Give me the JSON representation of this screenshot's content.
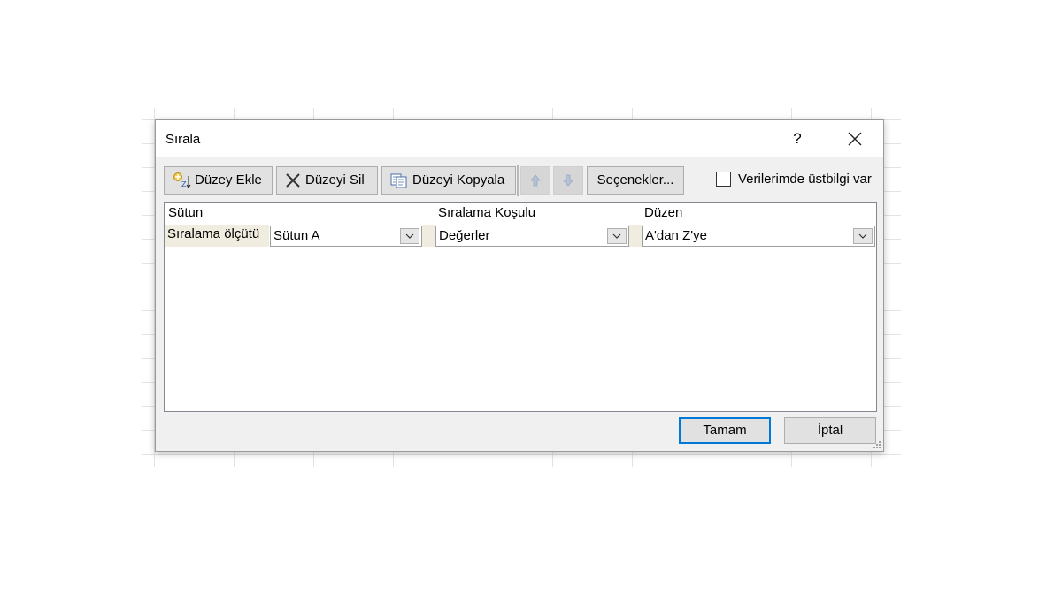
{
  "dialog": {
    "title": "Sırala",
    "help_label": "?"
  },
  "toolbar": {
    "add_level": "Düzey Ekle",
    "delete_level": "Düzeyi Sil",
    "copy_level": "Düzeyi Kopyala",
    "options": "Seçenekler...",
    "header_checkbox_label": "Verilerimde üstbilgi var",
    "header_checkbox_checked": false
  },
  "grid": {
    "columns": [
      "Sütun",
      "Sıralama Koşulu",
      "Düzen"
    ],
    "rows": [
      {
        "label": "Sıralama ölçütü",
        "column": "Sütun A",
        "sort_on": "Değerler",
        "order": "A'dan Z'ye"
      }
    ]
  },
  "footer": {
    "ok": "Tamam",
    "cancel": "İptal"
  },
  "colors": {
    "dialog_bg": "#f0f0f0",
    "row_highlight": "#f0ede0",
    "default_button_border": "#0078d7"
  }
}
